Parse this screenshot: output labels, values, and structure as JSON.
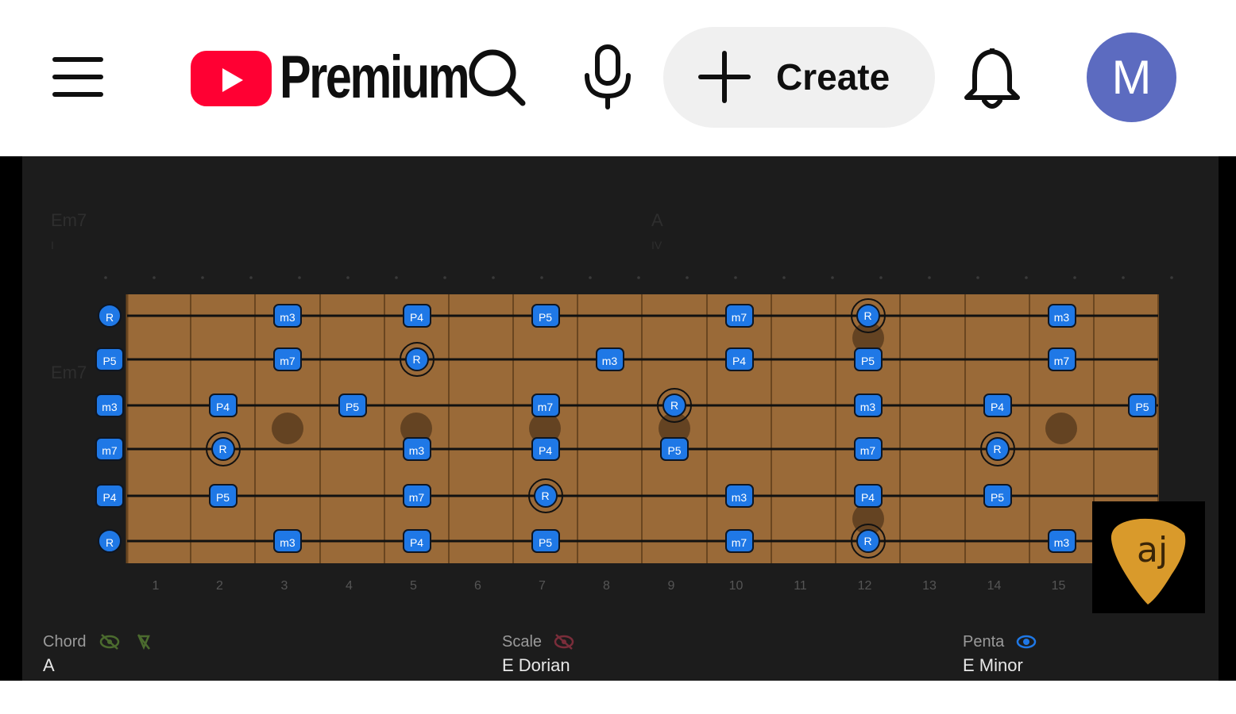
{
  "header": {
    "logo_text": "Premium",
    "create_label": "Create",
    "avatar_initial": "M",
    "colors": {
      "brand_red": "#ff0033",
      "avatar_bg": "#5c6bc0",
      "create_bg": "#f0f0f0"
    },
    "icons": [
      "menu-icon",
      "youtube-logo-icon",
      "search-icon",
      "mic-icon",
      "plus-icon",
      "bell-icon"
    ]
  },
  "video": {
    "chord_top_left": "Em7",
    "chord_top_left_numeral": "I",
    "chord_top_mid": "A",
    "chord_top_mid_numeral": "IV",
    "chord_side": "Em7",
    "fret_numbers": [
      "1",
      "2",
      "3",
      "4",
      "5",
      "6",
      "7",
      "8",
      "9",
      "10",
      "11",
      "12",
      "13",
      "14",
      "15"
    ],
    "open_notes": [
      "R",
      "P5",
      "m3",
      "m7",
      "P4",
      "R"
    ],
    "strings": [
      {
        "notes": [
          {
            "fret": 3,
            "label": "m3"
          },
          {
            "fret": 5,
            "label": "P4"
          },
          {
            "fret": 7,
            "label": "P5"
          },
          {
            "fret": 10,
            "label": "m7"
          },
          {
            "fret": 12,
            "label": "R",
            "root": true
          },
          {
            "fret": 15,
            "label": "m3"
          }
        ]
      },
      {
        "notes": [
          {
            "fret": 3,
            "label": "m7"
          },
          {
            "fret": 5,
            "label": "R",
            "root": true
          },
          {
            "fret": 8,
            "label": "m3"
          },
          {
            "fret": 10,
            "label": "P4"
          },
          {
            "fret": 12,
            "label": "P5"
          },
          {
            "fret": 15,
            "label": "m7"
          }
        ]
      },
      {
        "notes": [
          {
            "fret": 2,
            "label": "P4"
          },
          {
            "fret": 4,
            "label": "P5"
          },
          {
            "fret": 7,
            "label": "m7"
          },
          {
            "fret": 9,
            "label": "R",
            "root": true
          },
          {
            "fret": 12,
            "label": "m3"
          },
          {
            "fret": 14,
            "label": "P4"
          },
          {
            "fret": 16,
            "label": "P5"
          }
        ]
      },
      {
        "notes": [
          {
            "fret": 2,
            "label": "R",
            "root": true
          },
          {
            "fret": 5,
            "label": "m3"
          },
          {
            "fret": 7,
            "label": "P4"
          },
          {
            "fret": 9,
            "label": "P5"
          },
          {
            "fret": 12,
            "label": "m7"
          },
          {
            "fret": 14,
            "label": "R",
            "root": true
          }
        ]
      },
      {
        "notes": [
          {
            "fret": 2,
            "label": "P5"
          },
          {
            "fret": 5,
            "label": "m7"
          },
          {
            "fret": 7,
            "label": "R",
            "root": true
          },
          {
            "fret": 10,
            "label": "m3"
          },
          {
            "fret": 12,
            "label": "P4"
          },
          {
            "fret": 14,
            "label": "P5"
          }
        ]
      },
      {
        "notes": [
          {
            "fret": 3,
            "label": "m3"
          },
          {
            "fret": 5,
            "label": "P4"
          },
          {
            "fret": 7,
            "label": "P5"
          },
          {
            "fret": 10,
            "label": "m7"
          },
          {
            "fret": 12,
            "label": "R",
            "root": true
          },
          {
            "fret": 15,
            "label": "m3"
          }
        ]
      }
    ],
    "bottom": {
      "chord_label": "Chord",
      "chord_value": "A",
      "scale_label": "Scale",
      "scale_value": "E Dorian",
      "penta_label": "Penta",
      "penta_value": "E Minor"
    },
    "channel_logo_text": "aj",
    "colors": {
      "fretboard": "#9a6a38",
      "note": "#1f78e6",
      "background": "#1c1c1c",
      "eye_on": "#1f78e6",
      "eye_off_chord": "#4b6b2e",
      "eye_off_scale": "#7a2d3a"
    }
  }
}
